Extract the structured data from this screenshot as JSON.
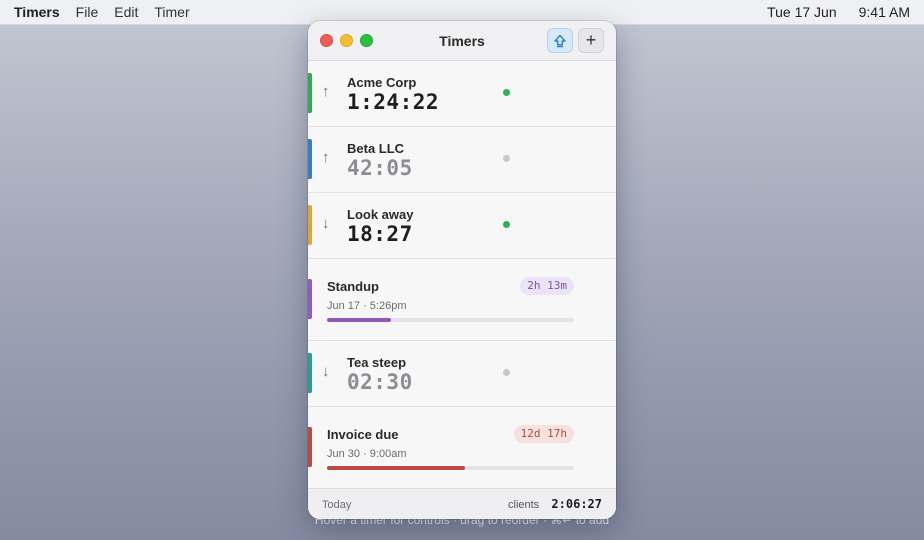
{
  "menubar": {
    "app": "Timers",
    "menus": [
      "File",
      "Edit",
      "Timer"
    ],
    "date": "Tue 17 Jun",
    "time": "9:41 AM"
  },
  "window": {
    "title": "Timers",
    "pin_icon": "pin-up-icon",
    "add_label": "+"
  },
  "timers": [
    {
      "name": "Acme Corp",
      "time": "1:24:22",
      "direction": "up",
      "arrow": "↑",
      "running": true,
      "color": "#34a853"
    },
    {
      "name": "Beta LLC",
      "time": "42:05",
      "direction": "up",
      "arrow": "↑",
      "running": false,
      "color": "#3b7dc4"
    },
    {
      "name": "Look away",
      "time": "18:27",
      "direction": "down",
      "arrow": "↓",
      "running": true,
      "color": "#e0a336"
    },
    {
      "name": "Standup",
      "date": "Jun 17 · 5:26pm",
      "badge": "2h 13m",
      "progress": 0.26,
      "color": "#8e5bbf",
      "badge_bg": "#ebe3f6",
      "badge_fg": "#7b51b2"
    },
    {
      "name": "Tea steep",
      "time": "02:30",
      "direction": "down",
      "arrow": "↓",
      "running": false,
      "color": "#2a9e8f"
    },
    {
      "name": "Invoice due",
      "date": "Jun 30 · 9:00am",
      "badge": "12d 17h",
      "progress": 0.56,
      "color": "#b94a44",
      "badge_bg": "#f6e1df",
      "badge_fg": "#b04a44"
    }
  ],
  "footer": {
    "left": "Today",
    "label": "clients",
    "total": "2:06:27"
  },
  "hint": "Hover a timer for controls · drag to reorder · ⌘↵ to add"
}
